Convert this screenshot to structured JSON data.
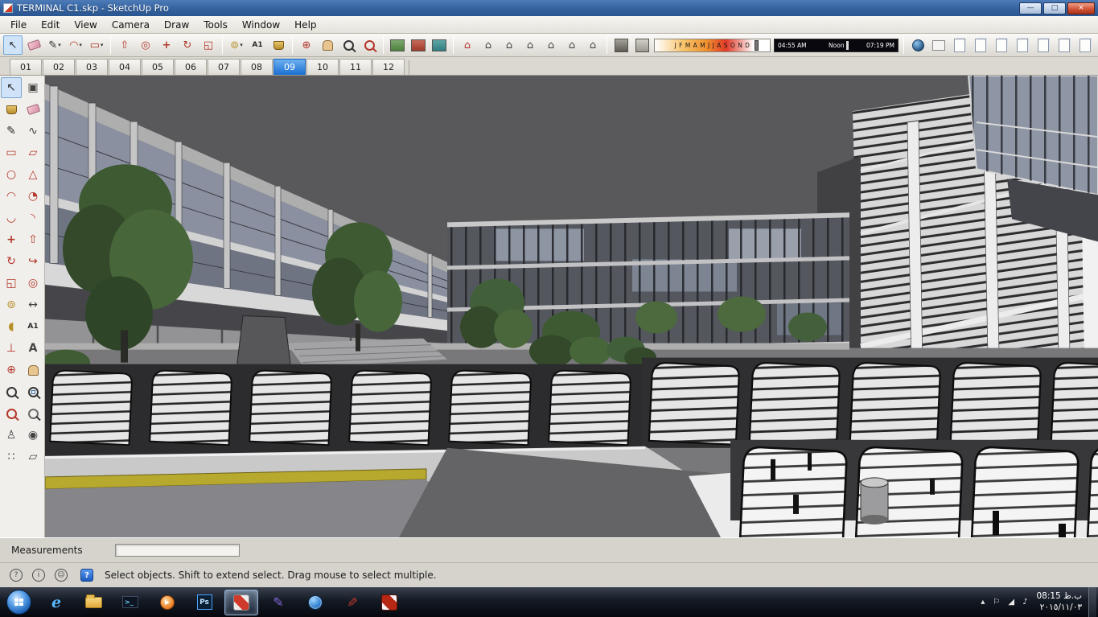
{
  "window": {
    "title": "TERMINAL C1.skp - SketchUp Pro"
  },
  "menu": {
    "items": [
      "File",
      "Edit",
      "View",
      "Camera",
      "Draw",
      "Tools",
      "Window",
      "Help"
    ]
  },
  "shadows": {
    "months": "J F M A M J J A S O N D",
    "time_start": "04:55 AM",
    "time_noon": "Noon",
    "time_end": "07:19 PM"
  },
  "scene_tabs": [
    "01",
    "02",
    "03",
    "04",
    "05",
    "06",
    "07",
    "08",
    "09",
    "10",
    "11",
    "12"
  ],
  "measurements": {
    "label": "Measurements",
    "value": ""
  },
  "status": {
    "hint": "Select objects. Shift to extend select. Drag mouse to select multiple."
  },
  "taskbar": {
    "time": "08:15 ب.ظ",
    "date": "٢٠١٥/١١/٠٣"
  },
  "icons": {
    "select": "↖",
    "make_component": "▣",
    "line": "✎",
    "freehand": "∿",
    "rectangle": "▭",
    "rotated_rectangle": "▱",
    "circle": "○",
    "polygon": "△",
    "arc": "◠",
    "pie": "◔",
    "arc2": "◡",
    "arc3": "◝",
    "move": "+",
    "push_pull": "⇧",
    "rotate": "↻",
    "follow_me": "↪",
    "scale": "◱",
    "offset": "◎",
    "tape": "⊚",
    "dimension": "↔",
    "protractor": "◖",
    "text": "A1",
    "axes": "⊥",
    "text3d": "A",
    "orbit": "⊕",
    "camera": "♙",
    "look": "◉",
    "walk": "∷",
    "section": "▱",
    "house": "⌂",
    "dropdown": "▾",
    "minimize": "—",
    "maximize": "□",
    "close": "×",
    "ie": "e",
    "prompt": ">_",
    "play": "▶",
    "ps": "Ps",
    "question": "?",
    "info": "i",
    "user": "☺",
    "tray_up": "▴",
    "flag": "⚐",
    "signal": "◢",
    "volume": "♪"
  }
}
